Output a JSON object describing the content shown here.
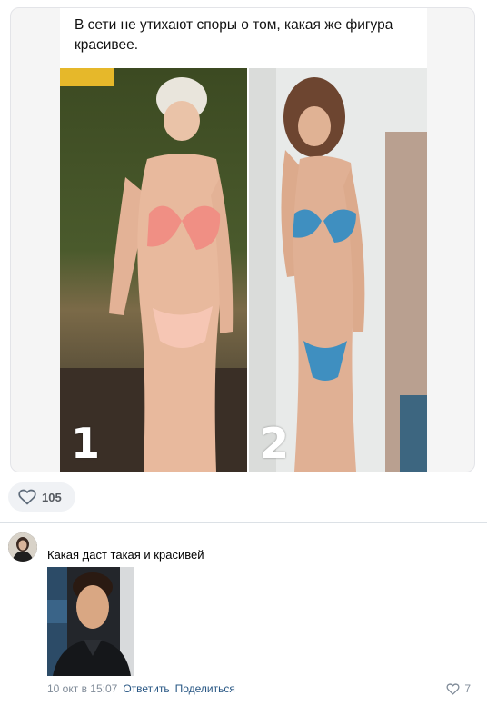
{
  "post": {
    "caption": "В сети не утихают споры о том, какая же фигура красивее.",
    "photo_left_label": "1",
    "photo_right_label": "2",
    "likes": "105"
  },
  "comment": {
    "text": "Какая даст такая и красивей",
    "time": "10 окт в 15:07",
    "reply_label": "Ответить",
    "share_label": "Поделиться",
    "likes": "7"
  },
  "colors": {
    "link": "#2a5885",
    "meta": "#818c99",
    "pill_bg": "#f0f2f5"
  },
  "icons": {
    "like": "heart-outline-icon"
  }
}
